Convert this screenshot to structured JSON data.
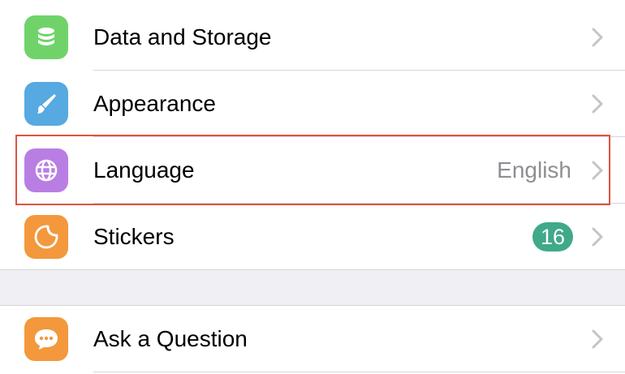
{
  "settings": {
    "items": [
      {
        "label": "Data and Storage",
        "icon": "database-icon",
        "icon_color": "#6fd36a"
      },
      {
        "label": "Appearance",
        "icon": "brush-icon",
        "icon_color": "#56a9e1"
      },
      {
        "label": "Language",
        "detail": "English",
        "icon": "globe-icon",
        "icon_color": "#b97ee3"
      },
      {
        "label": "Stickers",
        "badge": "16",
        "badge_color": "#3fa98a",
        "icon": "sticker-icon",
        "icon_color": "#f3983c"
      }
    ],
    "help_items": [
      {
        "label": "Ask a Question",
        "icon": "chat-bubble-icon",
        "icon_color": "#f3983c"
      }
    ]
  },
  "colors": {
    "highlight": "#e05341",
    "group_background": "#efeff4",
    "separator": "#d6d6da",
    "chevron": "#c4c4c7"
  }
}
